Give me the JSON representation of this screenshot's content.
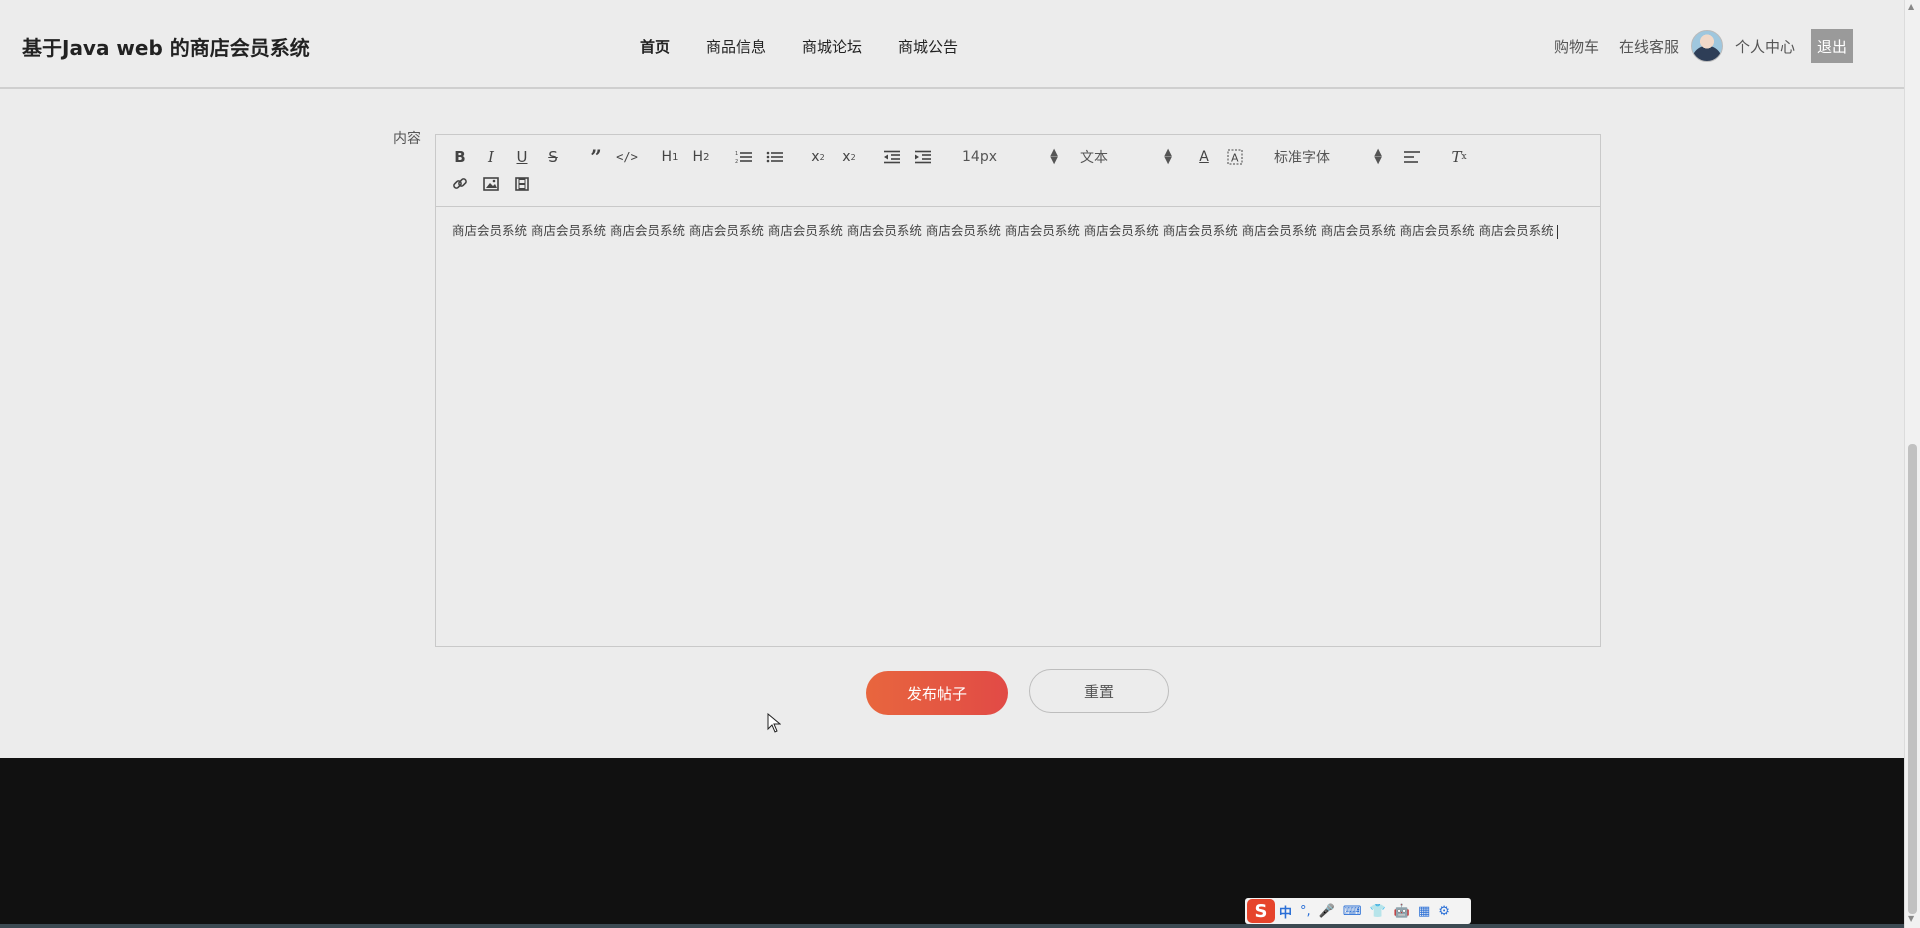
{
  "header": {
    "brand": "基于Java web 的商店会员系统",
    "nav": [
      {
        "label": "首页"
      },
      {
        "label": "商品信息"
      },
      {
        "label": "商城论坛"
      },
      {
        "label": "商城公告"
      }
    ],
    "cart": "购物车",
    "service": "在线客服",
    "profile": "个人中心",
    "logout": "退出"
  },
  "form": {
    "content_label": "内容",
    "toolbar": {
      "font_size": "14px",
      "block_type": "文本",
      "font_family": "标准字体"
    },
    "editor_text": "商店会员系统 商店会员系统 商店会员系统 商店会员系统 商店会员系统 商店会员系统 商店会员系统 商店会员系统 商店会员系统 商店会员系统 商店会员系统 商店会员系统 商店会员系统 商店会员系统",
    "publish_label": "发布帖子",
    "reset_label": "重置"
  },
  "ime": {
    "logo": "S",
    "mode": "中",
    "punct": "°,",
    "items": [
      "🎤",
      "⌨",
      "👕",
      "🤖",
      "▦",
      "⚙"
    ]
  }
}
